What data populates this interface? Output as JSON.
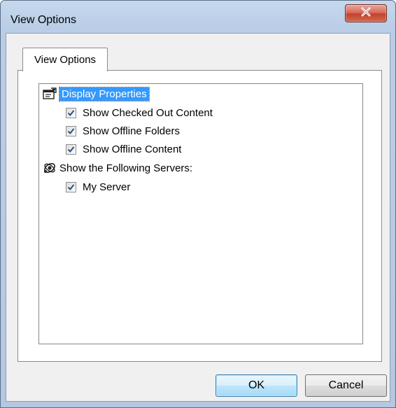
{
  "window": {
    "title": "View Options"
  },
  "tabs": [
    {
      "label": "View Options",
      "selected": true
    }
  ],
  "tree": {
    "groups": [
      {
        "label": "Display Properties",
        "icon": "properties-icon",
        "selected": true,
        "items": [
          {
            "label": "Show Checked Out Content",
            "checked": true
          },
          {
            "label": "Show Offline Folders",
            "checked": true
          },
          {
            "label": "Show Offline Content",
            "checked": true
          }
        ]
      },
      {
        "label": "Show the Following Servers:",
        "icon": "servers-icon",
        "selected": false,
        "items": [
          {
            "label": "My Server",
            "checked": true
          }
        ]
      }
    ]
  },
  "buttons": {
    "ok": "OK",
    "cancel": "Cancel"
  },
  "colors": {
    "selection": "#3399ff",
    "close_button": "#c3412f",
    "checkmark": "#2f4a8a"
  }
}
